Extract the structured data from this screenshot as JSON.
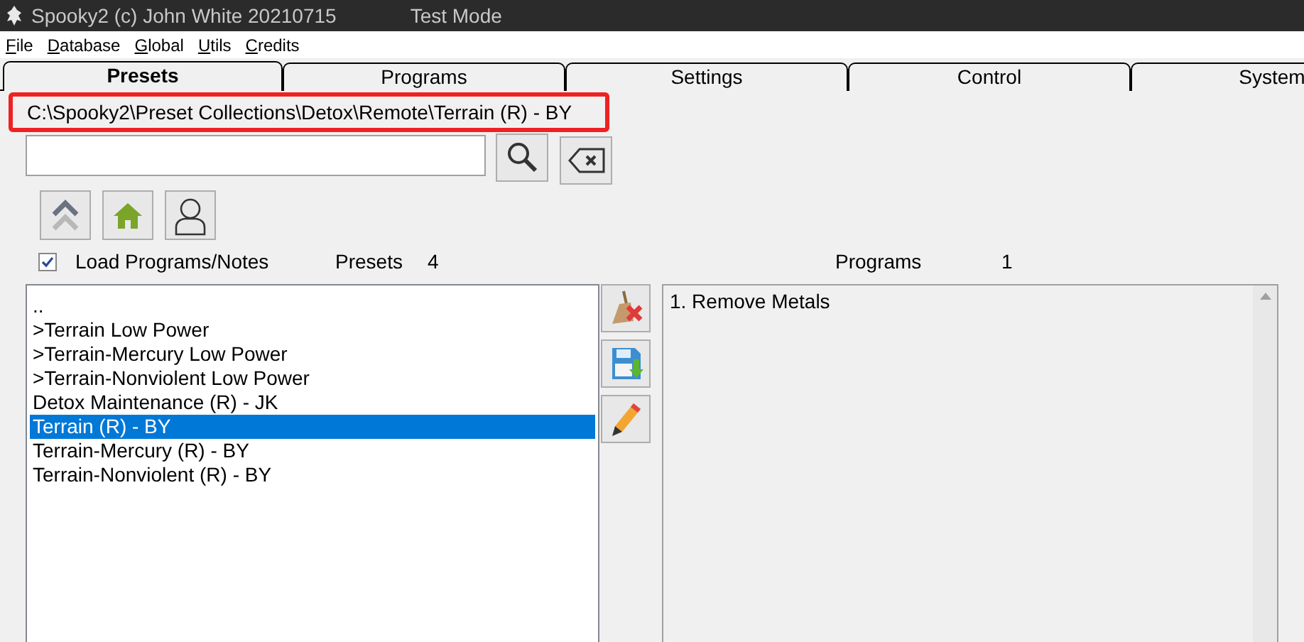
{
  "window": {
    "title": "Spooky2 (c) John White 20210715",
    "mode": "Test Mode"
  },
  "menu": [
    "File",
    "Database",
    "Global",
    "Utils",
    "Credits"
  ],
  "tabs": [
    {
      "label": "Presets",
      "selected": true
    },
    {
      "label": "Programs",
      "selected": false
    },
    {
      "label": "Settings",
      "selected": false
    },
    {
      "label": "Control",
      "selected": false
    },
    {
      "label": "System",
      "selected": false
    }
  ],
  "path_callout": "C:\\Spooky2\\Preset Collections\\Detox\\Remote\\Terrain (R) - BY",
  "load_programs_notes": {
    "label": "Load Programs/Notes",
    "checked": true
  },
  "presets": {
    "label": "Presets",
    "count": "4",
    "items": [
      {
        "text": "..",
        "selected": false
      },
      {
        "text": ">Terrain Low Power",
        "selected": false
      },
      {
        "text": ">Terrain-Mercury Low Power",
        "selected": false
      },
      {
        "text": ">Terrain-Nonviolent Low Power",
        "selected": false
      },
      {
        "text": "Detox Maintenance (R) - JK",
        "selected": false
      },
      {
        "text": "Terrain (R) - BY",
        "selected": true
      },
      {
        "text": "Terrain-Mercury (R) - BY",
        "selected": false
      },
      {
        "text": "Terrain-Nonviolent (R) - BY",
        "selected": false
      }
    ]
  },
  "programs": {
    "label": "Programs",
    "count": "1",
    "items": [
      "1. Remove Metals"
    ]
  }
}
